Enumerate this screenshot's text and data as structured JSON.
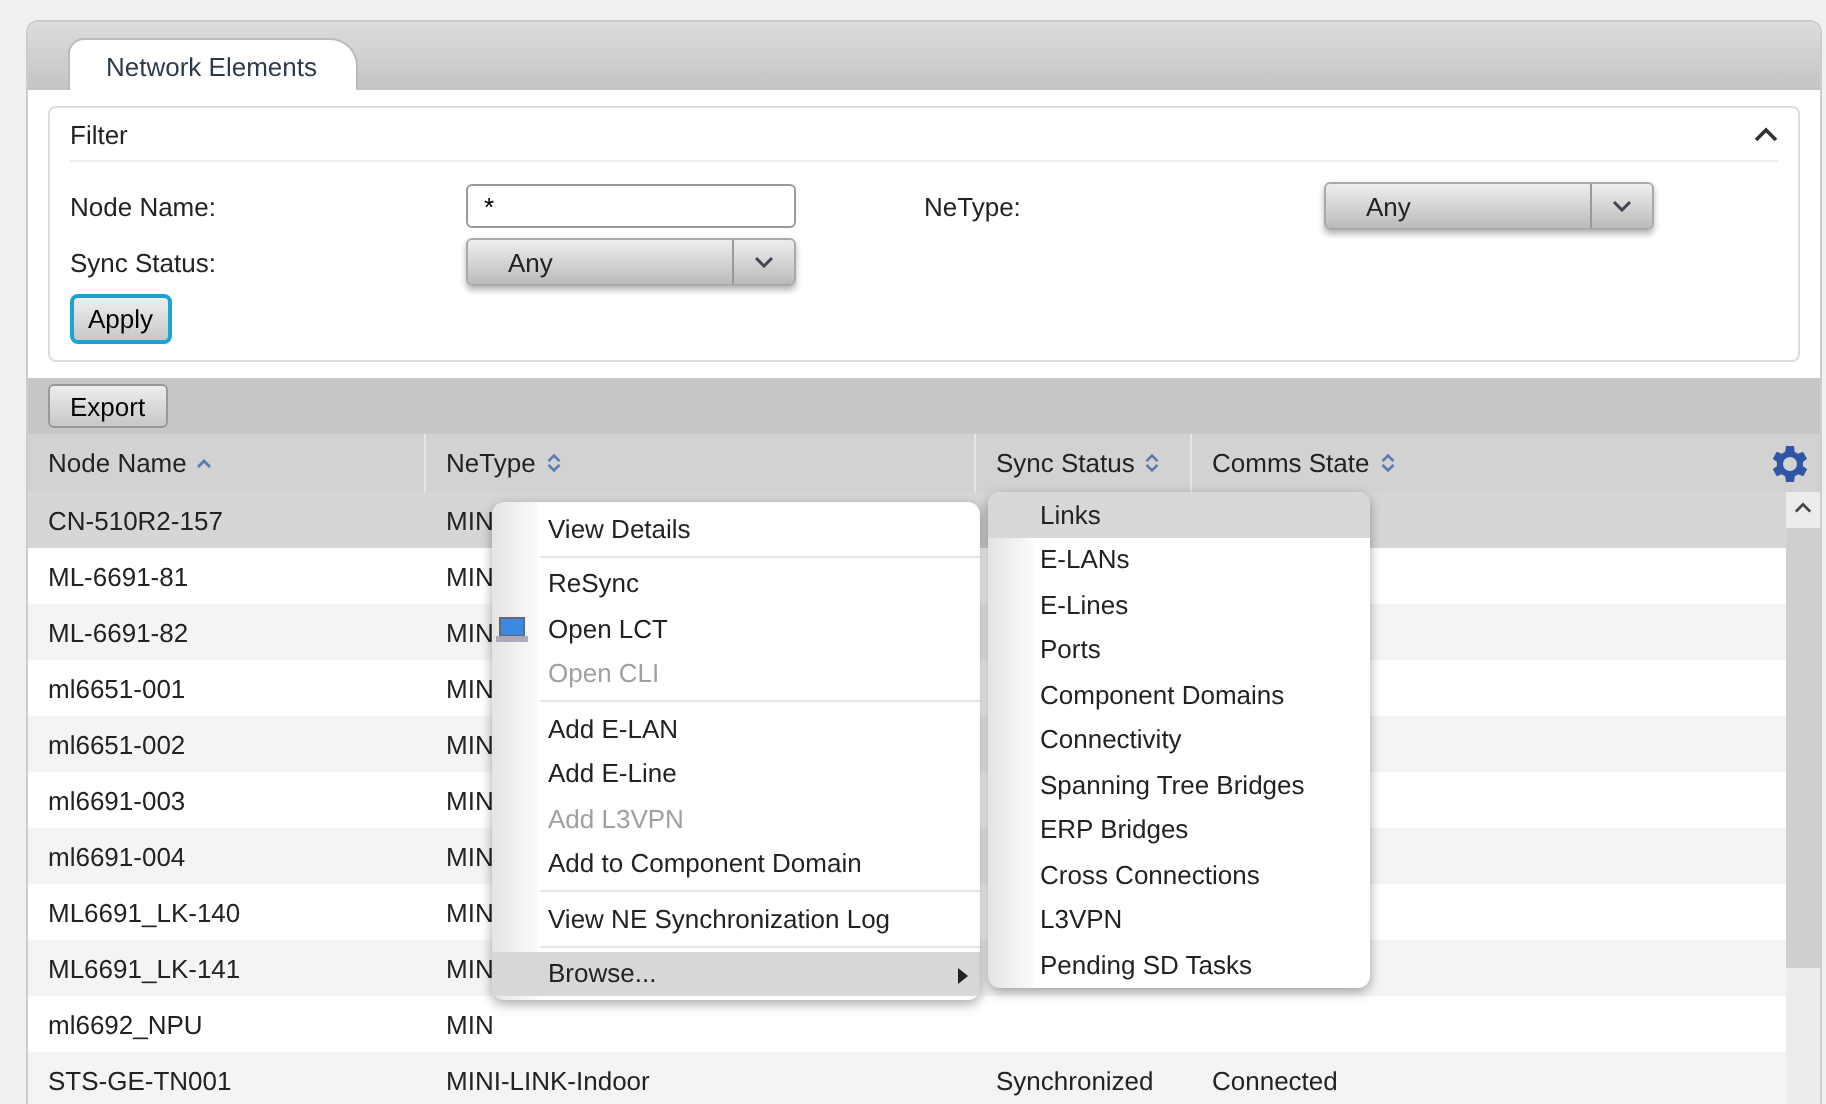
{
  "tabs": [
    {
      "label": "Network Elements",
      "selected": true
    }
  ],
  "filter": {
    "title": "Filter",
    "expanded": true,
    "node_name": {
      "label": "Node Name:",
      "value": "*"
    },
    "ne_type": {
      "label": "NeType:",
      "value": "Any"
    },
    "sync_status": {
      "label": "Sync Status:",
      "value": "Any"
    },
    "apply": "Apply"
  },
  "toolbar": {
    "export": "Export"
  },
  "table": {
    "columns": [
      {
        "label": "Node Name",
        "sorted": true
      },
      {
        "label": "NeType",
        "sorted": false
      },
      {
        "label": "Sync Status",
        "sorted": false
      },
      {
        "label": "Comms State",
        "sorted": false
      }
    ],
    "rows": [
      {
        "cells": [
          "CN-510R2-157",
          "MIN",
          "",
          ""
        ],
        "selected": true
      },
      {
        "cells": [
          "ML-6691-81",
          "MIN",
          "",
          ""
        ],
        "selected": false
      },
      {
        "cells": [
          "ML-6691-82",
          "MIN",
          "",
          ""
        ],
        "selected": false
      },
      {
        "cells": [
          "ml6651-001",
          "MIN",
          "",
          ""
        ],
        "selected": false
      },
      {
        "cells": [
          "ml6651-002",
          "MIN",
          "",
          ""
        ],
        "selected": false
      },
      {
        "cells": [
          "ml6691-003",
          "MIN",
          "",
          ""
        ],
        "selected": false
      },
      {
        "cells": [
          "ml6691-004",
          "MIN",
          "",
          ""
        ],
        "selected": false
      },
      {
        "cells": [
          "ML6691_LK-140",
          "MIN",
          "",
          ""
        ],
        "selected": false
      },
      {
        "cells": [
          "ML6691_LK-141",
          "MIN",
          "",
          ""
        ],
        "selected": false
      },
      {
        "cells": [
          "ml6692_NPU",
          "MIN",
          "",
          ""
        ],
        "selected": false
      },
      {
        "cells": [
          "STS-GE-TN001",
          "MINI-LINK-Indoor",
          "Synchronized",
          "Connected"
        ],
        "selected": false
      }
    ]
  },
  "context_menu": [
    {
      "kind": "item",
      "label": "View Details",
      "disabled": false,
      "selected": false
    },
    {
      "kind": "separator"
    },
    {
      "kind": "item",
      "label": "ReSync",
      "disabled": false,
      "selected": false
    },
    {
      "kind": "item",
      "label": "Open LCT",
      "disabled": false,
      "selected": false
    },
    {
      "kind": "item",
      "label": "Open CLI",
      "disabled": true,
      "selected": false
    },
    {
      "kind": "separator"
    },
    {
      "kind": "item",
      "label": "Add E-LAN",
      "disabled": false,
      "selected": false
    },
    {
      "kind": "item",
      "label": "Add E-Line",
      "disabled": false,
      "selected": false
    },
    {
      "kind": "item",
      "label": "Add L3VPN",
      "disabled": true,
      "selected": false
    },
    {
      "kind": "item",
      "label": "Add to Component Domain",
      "disabled": false,
      "selected": false
    },
    {
      "kind": "separator"
    },
    {
      "kind": "item",
      "label": "View NE Synchronization Log",
      "disabled": false,
      "selected": false
    },
    {
      "kind": "separator"
    },
    {
      "kind": "submenu",
      "label": "Browse...",
      "disabled": false,
      "selected": true
    }
  ],
  "submenu": [
    {
      "label": "Links",
      "selected": true
    },
    {
      "label": "E-LANs",
      "selected": false
    },
    {
      "label": "E-Lines",
      "selected": false
    },
    {
      "label": "Ports",
      "selected": false
    },
    {
      "label": "Component Domains",
      "selected": false
    },
    {
      "label": "Connectivity",
      "selected": false
    },
    {
      "label": "Spanning Tree Bridges",
      "selected": false
    },
    {
      "label": "ERP Bridges",
      "selected": false
    },
    {
      "label": "Cross Connections",
      "selected": false
    },
    {
      "label": "L3VPN",
      "selected": false
    },
    {
      "label": "Pending SD Tasks",
      "selected": false
    }
  ]
}
